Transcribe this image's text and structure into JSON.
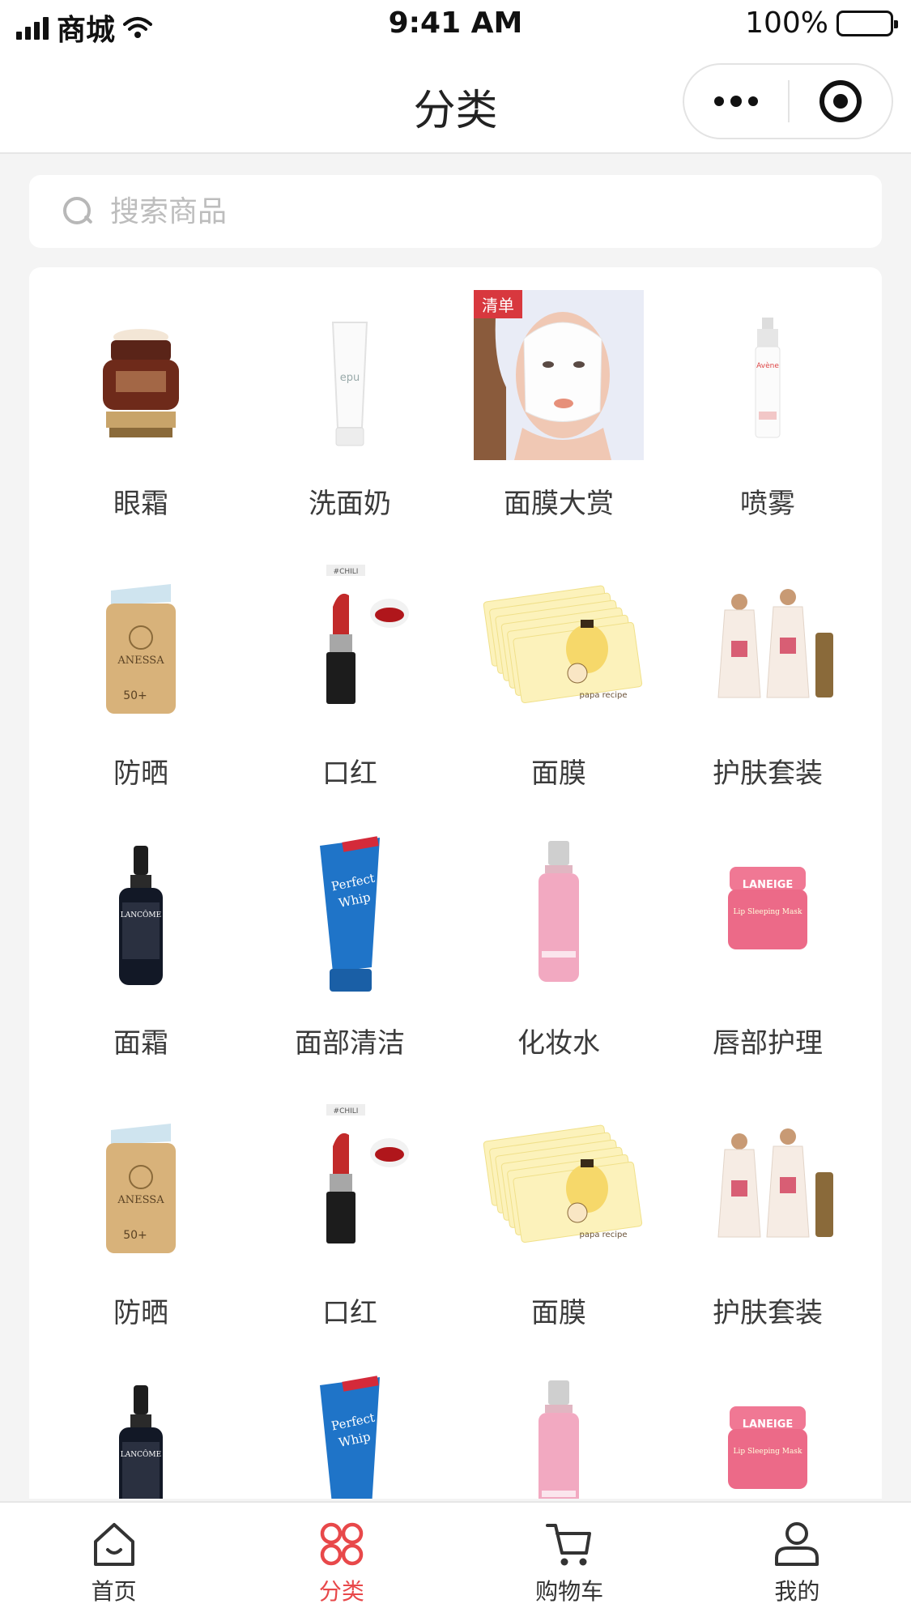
{
  "status_bar": {
    "carrier": "商城",
    "time": "9:41 AM",
    "battery": "100%"
  },
  "navbar": {
    "title": "分类"
  },
  "search": {
    "placeholder": "搜索商品"
  },
  "categories": [
    {
      "label": "眼霜",
      "image": "eye-cream-jar"
    },
    {
      "label": "洗面奶",
      "image": "cleanser-tube"
    },
    {
      "label": "面膜大赏",
      "image": "sheet-mask-model",
      "tag": "清单"
    },
    {
      "label": "喷雾",
      "image": "spray-can"
    },
    {
      "label": "防晒",
      "image": "sunscreen-bottle",
      "product_text": "ANESSA"
    },
    {
      "label": "口红",
      "image": "lipstick",
      "product_text": "#CHILI"
    },
    {
      "label": "面膜",
      "image": "mask-packets",
      "product_text": "papa recipe"
    },
    {
      "label": "护肤套装",
      "image": "skincare-set"
    },
    {
      "label": "面霜",
      "image": "serum-bottle",
      "product_text": "LANCÔME"
    },
    {
      "label": "面部清洁",
      "image": "foam-cleanser",
      "product_text": "Perfect Whip"
    },
    {
      "label": "化妆水",
      "image": "toner-bottle"
    },
    {
      "label": "唇部护理",
      "image": "lip-mask-jar",
      "product_text": "LANEIGE"
    },
    {
      "label": "防晒",
      "image": "sunscreen-bottle",
      "product_text": "ANESSA"
    },
    {
      "label": "口红",
      "image": "lipstick",
      "product_text": "#CHILI"
    },
    {
      "label": "面膜",
      "image": "mask-packets",
      "product_text": "papa recipe"
    },
    {
      "label": "护肤套装",
      "image": "skincare-set"
    },
    {
      "label": "",
      "image": "serum-bottle",
      "product_text": "LANCÔME"
    },
    {
      "label": "",
      "image": "foam-cleanser",
      "product_text": "Perfect Whip"
    },
    {
      "label": "",
      "image": "toner-bottle"
    },
    {
      "label": "",
      "image": "lip-mask-jar",
      "product_text": "LANEIGE"
    }
  ],
  "tabbar": [
    {
      "label": "首页",
      "icon": "home-icon",
      "active": false
    },
    {
      "label": "分类",
      "icon": "category-icon",
      "active": true
    },
    {
      "label": "购物车",
      "icon": "cart-icon",
      "active": false
    },
    {
      "label": "我的",
      "icon": "user-icon",
      "active": false
    }
  ],
  "colors": {
    "accent": "#e8484a",
    "tag_red": "#d8383e",
    "background": "#f4f4f4"
  }
}
